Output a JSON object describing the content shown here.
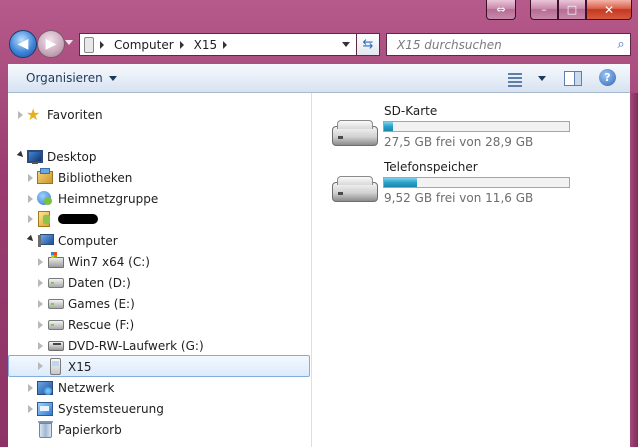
{
  "window": {
    "caption_buttons": {
      "swap": "⇔",
      "minimize": "–",
      "maximize": "□",
      "close": "✕"
    }
  },
  "address": {
    "segments": [
      "Computer",
      "X15"
    ],
    "search_placeholder": "X15 durchsuchen"
  },
  "toolbar": {
    "organize_label": "Organisieren",
    "help_label": "?"
  },
  "nav_tree": {
    "favorites": "Favoriten",
    "desktop": "Desktop",
    "libraries": "Bibliotheken",
    "homegroup": "Heimnetzgruppe",
    "computer": "Computer",
    "drives": [
      "Win7 x64 (C:)",
      "Daten (D:)",
      "Games (E:)",
      "Rescue (F:)",
      "DVD-RW-Laufwerk (G:)",
      "X15"
    ],
    "network": "Netzwerk",
    "control_panel": "Systemsteuerung",
    "recycle_bin": "Papierkorb"
  },
  "content": {
    "drives": [
      {
        "name": "SD-Karte",
        "free_text": "27,5 GB frei von 28,9 GB",
        "used_fraction": 0.05
      },
      {
        "name": "Telefonspeicher",
        "free_text": "9,52 GB frei von 11,6 GB",
        "used_fraction": 0.18
      }
    ]
  }
}
